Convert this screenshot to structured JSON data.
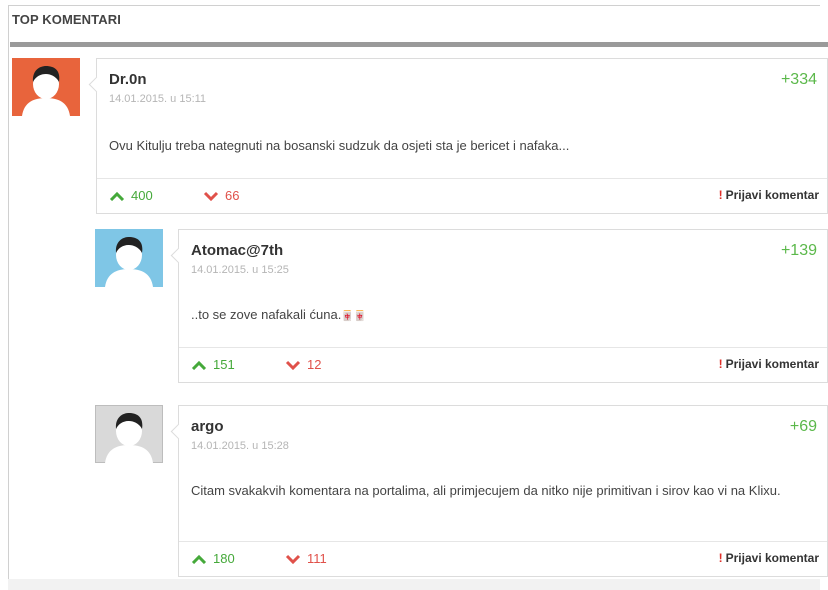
{
  "section": {
    "title": "TOP KOMENTARI"
  },
  "colors": {
    "positive": "#5bb84a",
    "negative": "#e0514a",
    "report_mark": "#e0302a"
  },
  "comments": [
    {
      "author": "Dr.0n",
      "date": "14.01.2015. u 15:11",
      "score": "+334",
      "text": "Ovu Kitulju treba nategnuti na bosanski sudzuk da osjeti sta je bericet i nafaka...",
      "upvotes": "400",
      "downvotes": "66",
      "report_label": "Prijavi komentar",
      "avatar_color": "#e8643c"
    },
    {
      "author": "Atomac@7th",
      "date": "14.01.2015. u 15:25",
      "score": "+139",
      "text": "..to se zove nafakali ćuna.",
      "text_glyphs": "🀄🀄",
      "upvotes": "151",
      "downvotes": "12",
      "report_label": "Prijavi komentar",
      "avatar_color": "#7fc6e6"
    },
    {
      "author": "argo",
      "date": "14.01.2015. u 15:28",
      "score": "+69",
      "text": "Citam svakakvih komentara na portalima, ali primjecujem da nitko nije primitivan i sirov kao vi na Klixu.",
      "upvotes": "180",
      "downvotes": "111",
      "report_label": "Prijavi komentar",
      "avatar_color": "#d9d9d9"
    }
  ]
}
